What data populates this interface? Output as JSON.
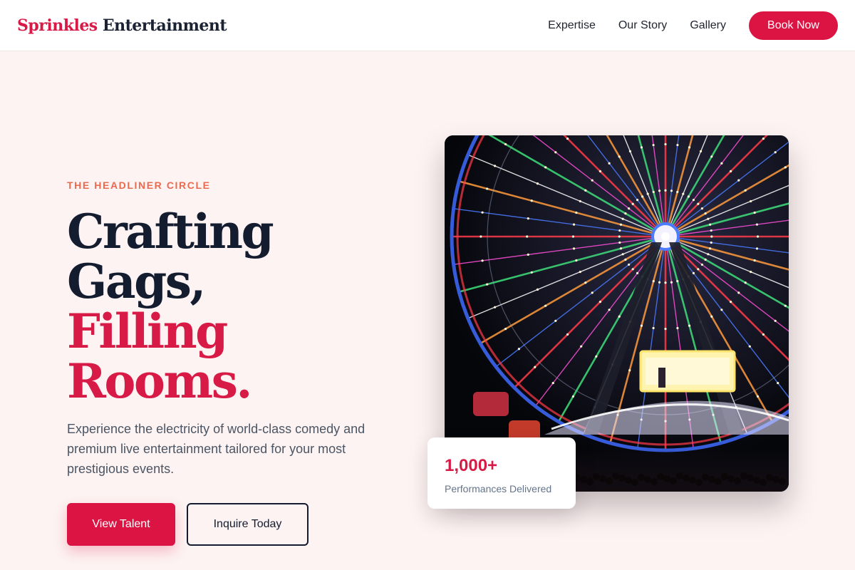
{
  "brand": {
    "name_accent": "Sprinkles",
    "name_rest": "Entertainment"
  },
  "nav": {
    "links": [
      "Expertise",
      "Our Story",
      "Gallery"
    ],
    "cta_label": "Book Now"
  },
  "hero": {
    "eyebrow": "THE HEADLINER CIRCLE",
    "headline_line1": "Crafting Gags,",
    "headline_line2": "Filling Rooms.",
    "description": "Experience the electricity of world-class comedy and premium live entertainment tailored for your most prestigious events.",
    "primary_cta": "View Talent",
    "secondary_cta": "Inquire Today"
  },
  "image": {
    "subject": "illuminated ferris wheel at night"
  },
  "stat": {
    "value": "1,000+",
    "label": "Performances Delivered"
  },
  "colors": {
    "accent": "#dc1443",
    "navy": "#141c30",
    "eyebrow": "#ea6a4f",
    "page_bg": "#fdf3f2"
  }
}
